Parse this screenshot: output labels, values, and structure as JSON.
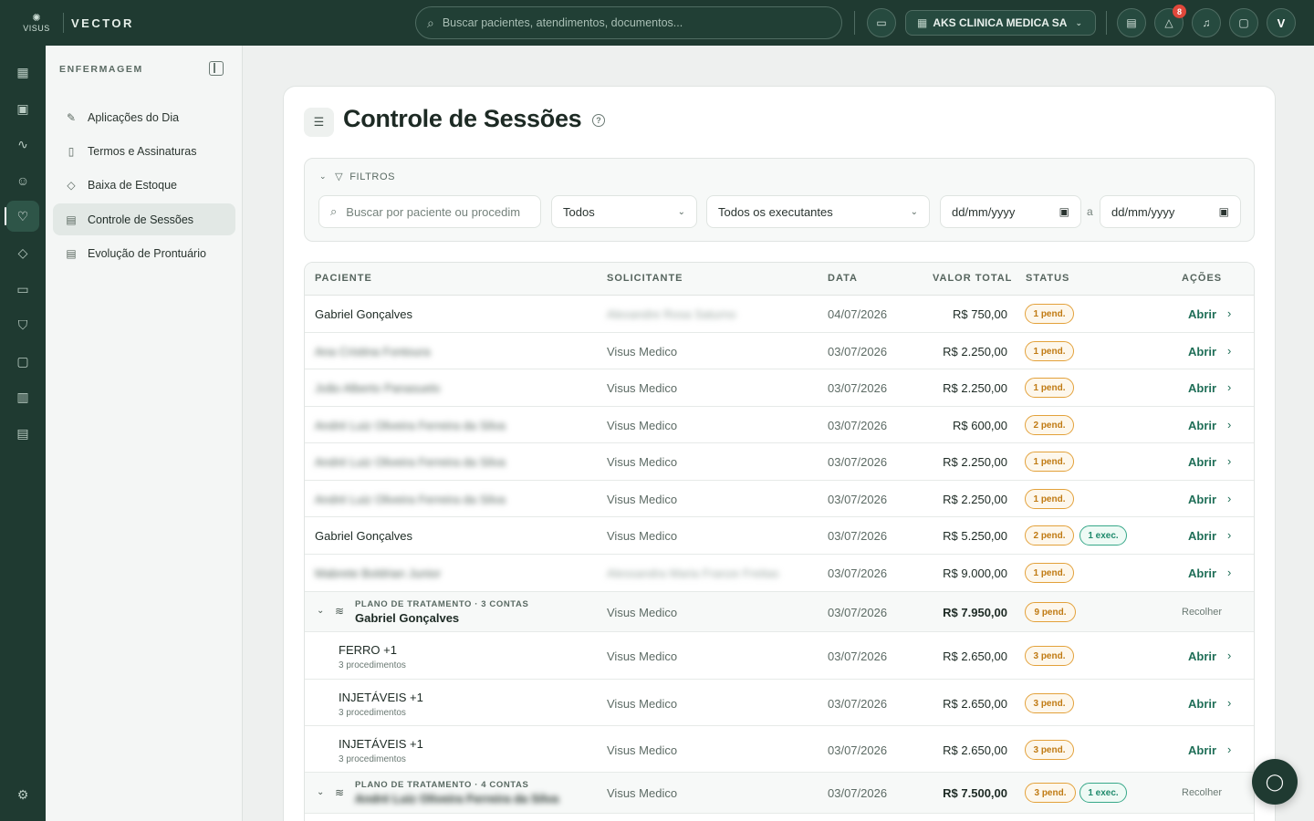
{
  "app": {
    "logo_text": "VISUS",
    "brand": "VECTOR"
  },
  "topbar": {
    "search_placeholder": "Buscar pacientes, atendimentos, documentos...",
    "clinic_name": "AKS CLINICA MEDICA SA",
    "alerts_count": "8",
    "avatar_initial": "V"
  },
  "rail": {
    "icons": [
      "grid-icon",
      "calendar-icon",
      "stethoscope-icon",
      "users-icon",
      "heart-pulse-icon",
      "box-icon",
      "wallet-icon",
      "shield-icon",
      "chat-icon",
      "report-icon",
      "document-icon"
    ],
    "settings_icon": "gear-icon"
  },
  "sidebar": {
    "section": "ENFERMAGEM",
    "items": [
      {
        "label": "Aplicações do Dia",
        "icon": "syringe-icon"
      },
      {
        "label": "Termos e Assinaturas",
        "icon": "sign-document-icon"
      },
      {
        "label": "Baixa de Estoque",
        "icon": "box-icon"
      },
      {
        "label": "Controle de Sessões",
        "icon": "clipboard-icon"
      },
      {
        "label": "Evolução de Prontuário",
        "icon": "clipboard-icon"
      }
    ]
  },
  "page": {
    "title": "Controle de Sessões"
  },
  "filters": {
    "title": "FILTROS",
    "search_placeholder": "Buscar por paciente ou procedim",
    "status_value": "Todos",
    "executor_value": "Todos os executantes",
    "date_from": "dd/mm/yyyy",
    "date_sep": "a",
    "date_to": "dd/mm/yyyy"
  },
  "table": {
    "headers": {
      "paciente": "PACIENTE",
      "solicitante": "SOLICITANTE",
      "data": "DATA",
      "valor": "VALOR TOTAL",
      "status": "STATUS",
      "acoes": "AÇÕES"
    },
    "action_open": "Abrir",
    "action_collapse": "Recolher",
    "rows": [
      {
        "paciente": "Gabriel Gonçalves",
        "solicitante": "Alexandre Rosa Saturno",
        "data": "04/07/2026",
        "valor": "R$ 750,00",
        "pend": "1 pend."
      },
      {
        "paciente": "Ana Cristina Fontoura",
        "solicitante": "Visus Medico",
        "data": "03/07/2026",
        "valor": "R$ 2.250,00",
        "pend": "1 pend."
      },
      {
        "paciente": "João Alberto Panasuelo",
        "solicitante": "Visus Medico",
        "data": "03/07/2026",
        "valor": "R$ 2.250,00",
        "pend": "1 pend."
      },
      {
        "paciente": "André Luiz Oliveira Ferreira da Silva",
        "solicitante": "Visus Medico",
        "data": "03/07/2026",
        "valor": "R$ 600,00",
        "pend": "2 pend."
      },
      {
        "paciente": "André Luiz Oliveira Ferreira da Silva",
        "solicitante": "Visus Medico",
        "data": "03/07/2026",
        "valor": "R$ 2.250,00",
        "pend": "1 pend."
      },
      {
        "paciente": "André Luiz Oliveira Ferreira da Silva",
        "solicitante": "Visus Medico",
        "data": "03/07/2026",
        "valor": "R$ 2.250,00",
        "pend": "1 pend."
      },
      {
        "paciente": "Gabriel Gonçalves",
        "solicitante": "Visus Medico",
        "data": "03/07/2026",
        "valor": "R$ 5.250,00",
        "pend": "2 pend.",
        "exec": "1 exec."
      },
      {
        "paciente": "Mabrete Boldrian Junior",
        "solicitante": "Alessandra Maria Franze Freitas",
        "data": "03/07/2026",
        "valor": "R$ 9.000,00",
        "pend": "1 pend."
      }
    ],
    "group1": {
      "label": "PLANO DE TRATAMENTO · 3 CONTAS",
      "name": "Gabriel Gonçalves",
      "solicitante": "Visus Medico",
      "data": "03/07/2026",
      "valor": "R$ 7.950,00",
      "pend": "9 pend.",
      "children": [
        {
          "name": "FERRO +1",
          "count": "3 procedimentos",
          "solicitante": "Visus Medico",
          "data": "03/07/2026",
          "valor": "R$ 2.650,00",
          "pend": "3 pend."
        },
        {
          "name": "INJETÁVEIS +1",
          "count": "3 procedimentos",
          "solicitante": "Visus Medico",
          "data": "03/07/2026",
          "valor": "R$ 2.650,00",
          "pend": "3 pend."
        },
        {
          "name": "INJETÁVEIS +1",
          "count": "3 procedimentos",
          "solicitante": "Visus Medico",
          "data": "03/07/2026",
          "valor": "R$ 2.650,00",
          "pend": "3 pend."
        }
      ]
    },
    "group2": {
      "label": "PLANO DE TRATAMENTO · 4 CONTAS",
      "name": "André Luiz Oliveira Ferreira da Silva",
      "solicitante": "Visus Medico",
      "data": "03/07/2026",
      "valor": "R$ 7.500,00",
      "pend": "3 pend.",
      "exec": "1 exec."
    }
  },
  "colors": {
    "primary_dark": "#1f3a31",
    "accent_green": "#1f6e57",
    "pending_orange": "#e3a13a",
    "exec_teal": "#37a889",
    "alert_red": "#e0483b"
  }
}
